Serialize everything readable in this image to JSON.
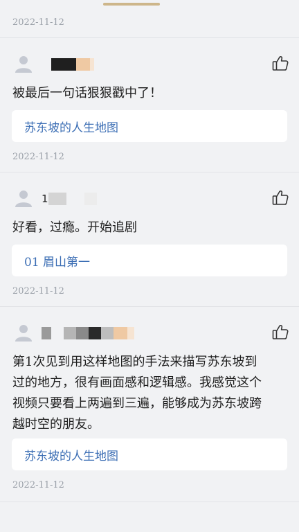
{
  "top": {
    "date": "2022-11-12"
  },
  "comments": [
    {
      "username": "",
      "text": "被最后一句话狠狠戳中了！",
      "topic": "苏东坡的人生地图",
      "date": "2022-11-12"
    },
    {
      "username": "1",
      "text": "好看，过瘾。开始追剧",
      "topic": "01 眉山第一",
      "date": "2022-11-12"
    },
    {
      "username": "",
      "text_lines": [
        "第1次见到用这样地图的手法来描写苏东坡到",
        "过的地方，很有画面感和逻辑感。我感觉这个",
        "视频只要看上两遍到三遍，能够成为苏东坡跨",
        "越时空的朋友。"
      ],
      "topic": "苏东坡的人生地图",
      "date": "2022-11-12"
    }
  ],
  "colors": {
    "accent": "#cdb68a",
    "link": "#3d6fb5",
    "date": "#9aa0a8",
    "background": "#f1f2f4"
  },
  "icons": {
    "avatar": "user-avatar-icon",
    "like": "thumbs-up-icon"
  }
}
